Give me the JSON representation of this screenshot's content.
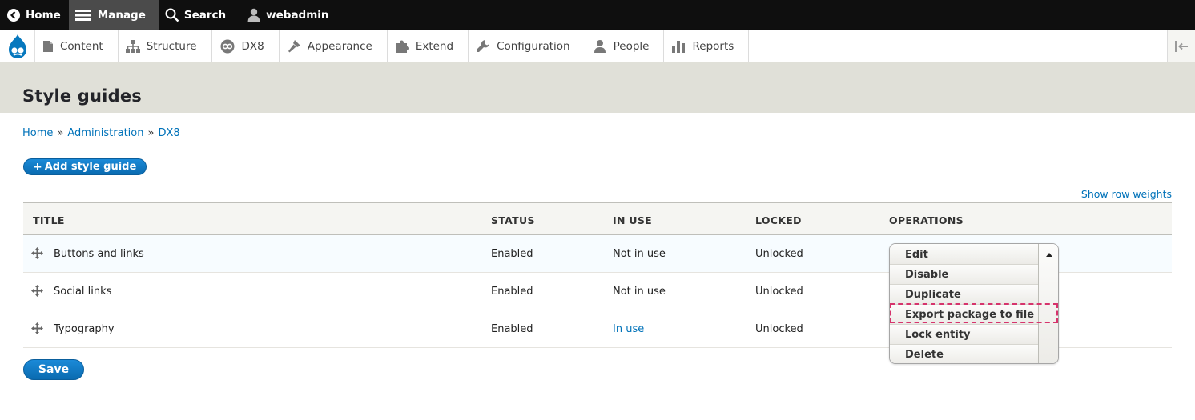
{
  "toolbar": {
    "home": "Home",
    "manage": "Manage",
    "search": "Search",
    "user": "webadmin"
  },
  "tray": {
    "items": [
      {
        "label": "Content",
        "icon": "content-icon"
      },
      {
        "label": "Structure",
        "icon": "structure-icon"
      },
      {
        "label": "DX8",
        "icon": "dx8-icon"
      },
      {
        "label": "Appearance",
        "icon": "appearance-icon"
      },
      {
        "label": "Extend",
        "icon": "extend-icon"
      },
      {
        "label": "Configuration",
        "icon": "configuration-icon"
      },
      {
        "label": "People",
        "icon": "people-icon"
      },
      {
        "label": "Reports",
        "icon": "reports-icon"
      }
    ]
  },
  "page": {
    "title": "Style guides",
    "breadcrumb": [
      "Home",
      "Administration",
      "DX8"
    ],
    "breadcrumb_sep": "»",
    "add_button": "Add style guide",
    "add_plus": "+",
    "row_weights": "Show row weights",
    "save_button": "Save"
  },
  "table": {
    "headers": [
      "TITLE",
      "STATUS",
      "IN USE",
      "LOCKED",
      "OPERATIONS"
    ],
    "rows": [
      {
        "title": "Buttons and links",
        "status": "Enabled",
        "in_use": "Not in use",
        "locked": "Unlocked"
      },
      {
        "title": "Social links",
        "status": "Enabled",
        "in_use": "Not in use",
        "locked": "Unlocked"
      },
      {
        "title": "Typography",
        "status": "Enabled",
        "in_use": "In use",
        "locked": "Unlocked"
      }
    ]
  },
  "dropbutton": {
    "items": [
      "Edit",
      "Disable",
      "Duplicate",
      "Export package to file",
      "Lock entity",
      "Delete"
    ],
    "highlighted": "Export package to file"
  },
  "colors": {
    "link": "#0072b9",
    "button": "#0071b8",
    "toolbar_bg": "#0f0f0f",
    "header_bg": "#e0e0d8",
    "highlight": "#d6336c"
  }
}
